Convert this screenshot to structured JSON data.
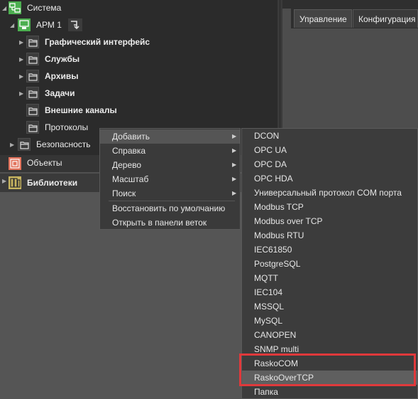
{
  "tree": {
    "items": [
      {
        "label": "Система",
        "icon": "system-icon"
      },
      {
        "label": "АРМ 1",
        "icon": "workstation-icon"
      },
      {
        "label": "Графический интерфейс",
        "icon": "folder-icon"
      },
      {
        "label": "Службы",
        "icon": "folder-icon"
      },
      {
        "label": "Архивы",
        "icon": "folder-icon"
      },
      {
        "label": "Задачи",
        "icon": "folder-icon"
      },
      {
        "label": "Внешние каналы",
        "icon": "folder-icon"
      },
      {
        "label": "Протоколы",
        "icon": "folder-icon"
      },
      {
        "label": "Безопасность",
        "icon": "folder-icon"
      }
    ],
    "objects_label": "Объекты",
    "libraries_label": "Библиотеки"
  },
  "tabs": [
    "Управление",
    "Конфигурация"
  ],
  "context_menu": {
    "items": [
      "Добавить",
      "Справка",
      "Дерево",
      "Масштаб",
      "Поиск",
      "Восстановить по умолчанию",
      "Открыть в панели веток"
    ],
    "active": "Добавить"
  },
  "submenu": {
    "items": [
      "DCON",
      "OPC UA",
      "OPC DA",
      "OPC HDA",
      "Универсальный протокол COM порта",
      "Modbus TCP",
      "Modbus over TCP",
      "Modbus RTU",
      "IEC61850",
      "PostgreSQL",
      "MQTT",
      "IEC104",
      "MSSQL",
      "MySQL",
      "CANOPEN",
      "SNMP multi",
      "RaskoCOM",
      "RaskoOverTCP",
      "Папка"
    ],
    "highlighted": "RaskoOverTCP"
  },
  "colors": {
    "highlight_box": "#e0393b",
    "system_icon": "#4caf50",
    "objects_icon": "#e2725b",
    "libraries_icon": "#c8b560"
  }
}
